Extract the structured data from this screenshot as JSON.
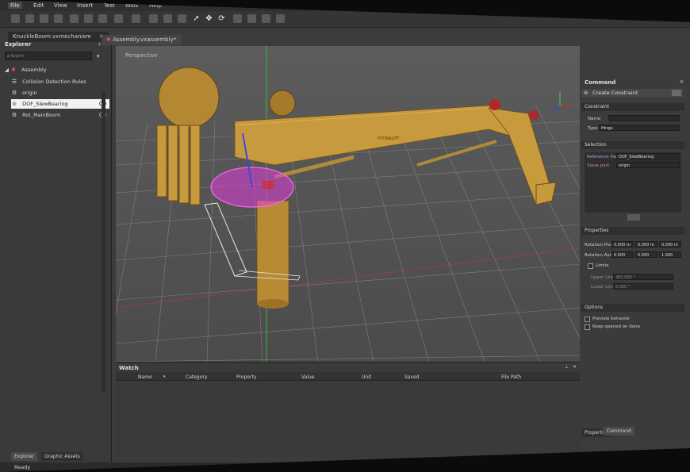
{
  "menu": [
    "File",
    "Edit",
    "View",
    "Insert",
    "Test",
    "Tools",
    "Help"
  ],
  "tabs": {
    "doc1": "KnuckleBoom.vxmechanism",
    "doc2": "Assembly.vxassembly*"
  },
  "explorer": {
    "title": "Explorer",
    "search_placeholder": "Search",
    "root": "Assembly",
    "items": [
      {
        "label": "Collision Detection Rules",
        "icon": "rules-icon"
      },
      {
        "label": "origin",
        "icon": "gear-icon"
      },
      {
        "label": "DOF_SlewBearing",
        "icon": "joint-icon",
        "selected": true
      },
      {
        "label": "Rot_MainBoom",
        "icon": "gear-icon"
      }
    ],
    "bottom_tabs": [
      "Explorer",
      "Graphic Assets"
    ]
  },
  "viewport": {
    "projection_label": "Perspective",
    "boom_brand": "HYDRALIFT"
  },
  "command": {
    "title": "Command",
    "header": "Create Constraint",
    "constraint_section": "Constraint",
    "name_label": "Name",
    "type_label": "Type",
    "type_value": "Hinge",
    "selection_section": "Selection",
    "reference_part_label": "Reference Part",
    "reference_part_value": "DOF_SlewBearing",
    "slave_part_label": "Slave part",
    "slave_part_value": "origin",
    "properties_section": "Properties",
    "rotation_pivot_label": "Rotation Pivot",
    "rotation_pivot_values": [
      "0.000 m",
      "0.000 m",
      "0.000 m"
    ],
    "rotation_axis_label": "Rotation Axis",
    "rotation_axis_values": [
      "0.000",
      "0.000",
      "1.000"
    ],
    "limits_label": "Limits",
    "upper_limit_label": "Upper Limit",
    "upper_limit_value": "360.000 °",
    "lower_limit_label": "Lower Limit",
    "lower_limit_value": "0.000 °",
    "options_section": "Options",
    "preview_behavior_label": "Preview behavior",
    "keep_opened_label": "Keep opened on done",
    "bottom_tabs": [
      "Properties",
      "Command"
    ]
  },
  "watch": {
    "title": "Watch",
    "columns": [
      "Name",
      "Category",
      "Property",
      "Value",
      "Unit",
      "Saved",
      "File Path"
    ]
  },
  "status": {
    "text": "Ready"
  },
  "colors": {
    "accent_magenta": "#e03cd8",
    "boom_yellow": "#c89a3e",
    "axis_red": "#d23030",
    "axis_green": "#3cbf3c",
    "axis_blue": "#3a4adf"
  }
}
